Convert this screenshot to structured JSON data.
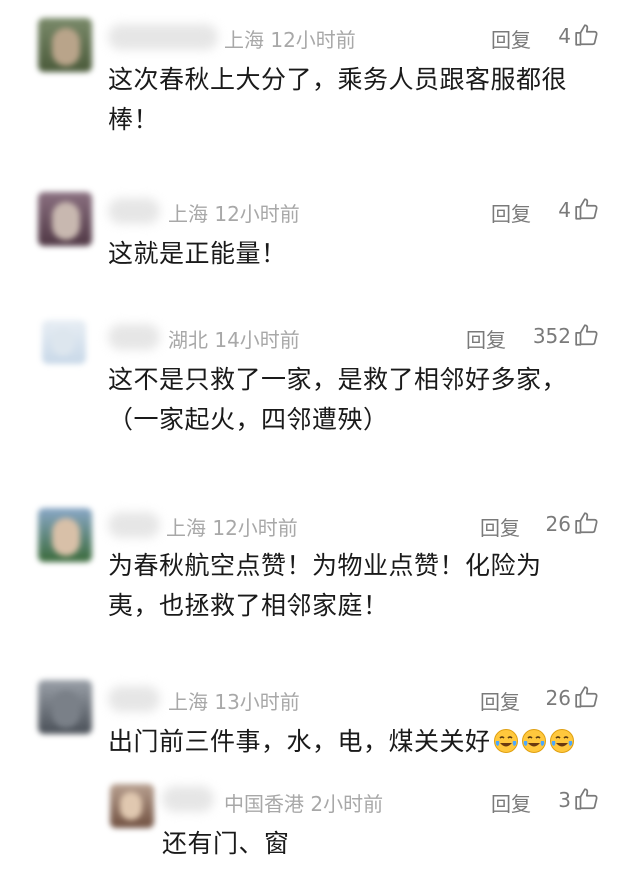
{
  "comments": [
    {
      "location": "上海",
      "time": "12小时前",
      "reply": "回复",
      "likes": "4",
      "line1": "这次春秋上大分了，乘务人员跟客服都很",
      "line2": "棒！"
    },
    {
      "location": "上海",
      "time": "12小时前",
      "reply": "回复",
      "likes": "4",
      "line1": "这就是正能量！"
    },
    {
      "location": "湖北",
      "time": "14小时前",
      "reply": "回复",
      "likes": "352",
      "line1": "这不是只救了一家，是救了相邻好多家，",
      "line2": "（一家起火，四邻遭殃）"
    },
    {
      "location": "上海",
      "time": "12小时前",
      "reply": "回复",
      "likes": "26",
      "line1": "为春秋航空点赞！为物业点赞！化险为",
      "line2": "夷，也拯救了相邻家庭！"
    },
    {
      "location": "上海",
      "time": "13小时前",
      "reply": "回复",
      "likes": "26",
      "line1": "出门前三件事，水，电，煤关关好",
      "emoji_count": 3,
      "emoji_name": "laughing-crying-emoji"
    }
  ],
  "sub_reply": {
    "location": "中国香港",
    "time": "2小时前",
    "reply": "回复",
    "likes": "3",
    "line1": "还有门、窗"
  },
  "icons": {
    "like": "thumbs-up-icon",
    "emoji": "laughing-crying-emoji"
  }
}
